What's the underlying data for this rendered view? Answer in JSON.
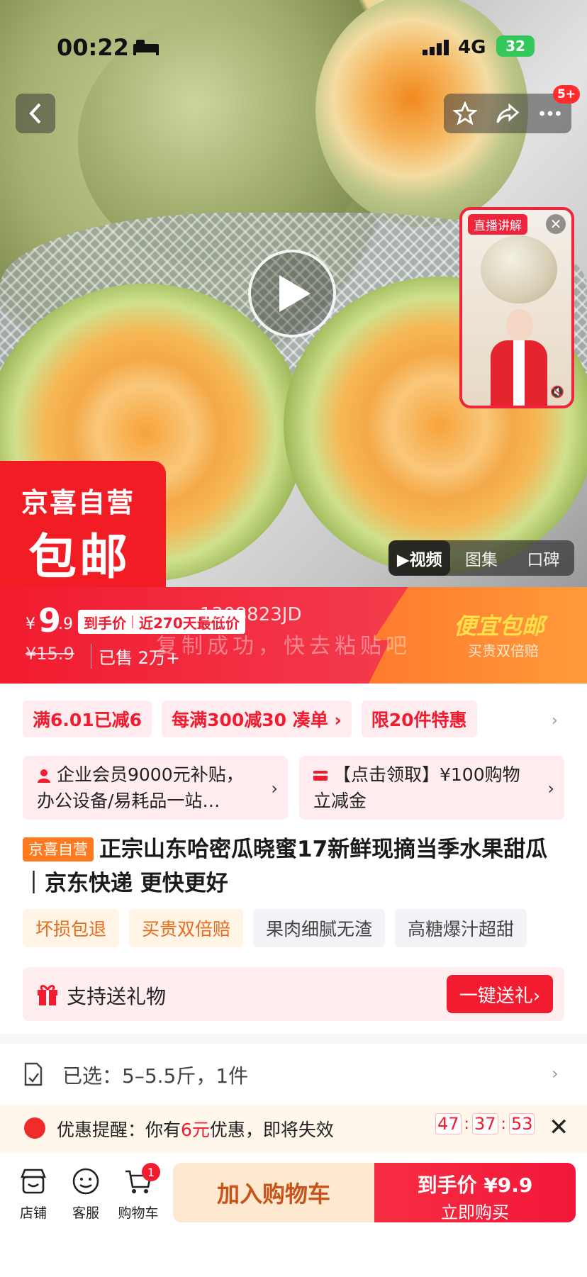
{
  "status": {
    "time": "00:22",
    "network": "4G",
    "battery": "32"
  },
  "nav": {
    "badge": "5+"
  },
  "live": {
    "tag": "直播讲解",
    "close": "✕"
  },
  "brand": {
    "line1": "京喜自营",
    "line2": "包邮"
  },
  "media_tabs": [
    "▶视频",
    "图集",
    "口碑"
  ],
  "price": {
    "yen": "¥",
    "int": "9",
    "dec": ".9",
    "chip_label": "到手价",
    "chip_text": "近270天最低价",
    "ghost_code": "1308823JD",
    "ghost_hint": "复制成功，快去粘贴吧",
    "original": "¥15.9",
    "sold": "已售 2万+",
    "slogan": "便宜包邮",
    "slogan_sub": "买贵双倍赔"
  },
  "promos": [
    "满6.01已减6",
    "每满300减30 凑单 ›",
    "限20件特惠"
  ],
  "coupons": {
    "c1": "企业会员9000元补贴，办公设备/易耗品一站…",
    "c2": "【点击领取】¥100购物立减金"
  },
  "title": {
    "badge": "京喜自营",
    "text": "正宗山东哈密瓜晓蜜17新鲜现摘当季水果甜瓜｜京东快递 更快更好"
  },
  "tags": [
    "坏损包退",
    "买贵双倍赔",
    "果肉细腻无渣",
    "高糖爆汁超甜"
  ],
  "gift": {
    "label": "支持送礼物",
    "button": "一键送礼›"
  },
  "selected": {
    "text": "已选：5–5.5斤，1件"
  },
  "reminder": {
    "prefix": "优惠提醒：你有",
    "amount": "6元",
    "suffix": "优惠，即将失效",
    "h": "47",
    "m": "37",
    "s": "53"
  },
  "bottom": {
    "shop": "店铺",
    "service": "客服",
    "cart": "购物车",
    "cart_count": "1",
    "add_cart": "加入购物车",
    "buy_l1": "到手价 ¥9.9",
    "buy_l2": "立即购买"
  },
  "colors": {
    "accent": "#f21b2f",
    "orange": "#ff7a2e"
  }
}
